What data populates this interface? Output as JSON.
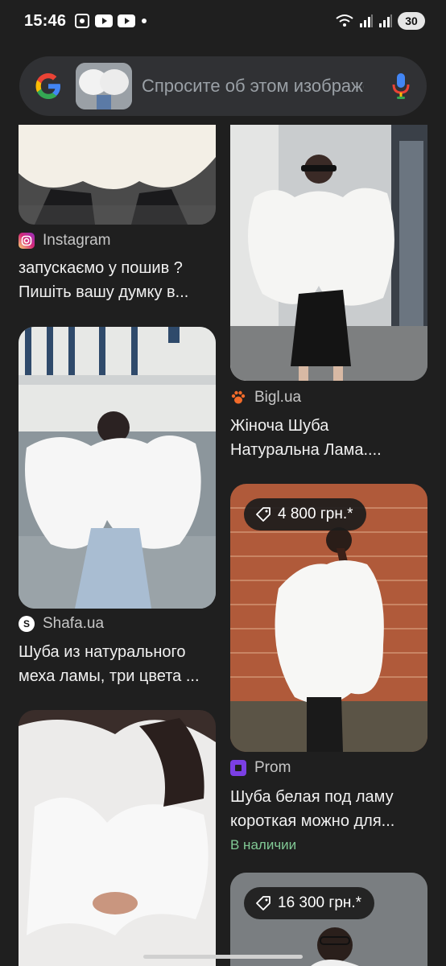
{
  "status_bar": {
    "time": "15:46",
    "battery": "30"
  },
  "search": {
    "placeholder": "Спросите об этом изображении"
  },
  "results": [
    {
      "source": "Instagram",
      "title_line1": "запускаємо у пошив ?",
      "title_line2": "Пишіть вашу думку в..."
    },
    {
      "source": "Bigl.ua",
      "title_line1": "Жіноча Шуба",
      "title_line2": "Натуральна Лама...."
    },
    {
      "source": "Shafa.ua",
      "title_line1": "Шуба из натурального",
      "title_line2": "меха ламы, три цвета ..."
    },
    {
      "source": "Prom",
      "price": "4 800 грн.*",
      "title_line1": "Шуба белая под ламу",
      "title_line2": "короткая можно для...",
      "availability": "В наличии"
    },
    {
      "price": "16 300 грн.*"
    }
  ],
  "colors": {
    "background": "#1f1f1f",
    "search_bar": "#303134",
    "in_stock": "#81c995",
    "price_badge": "#1c1c1c"
  }
}
